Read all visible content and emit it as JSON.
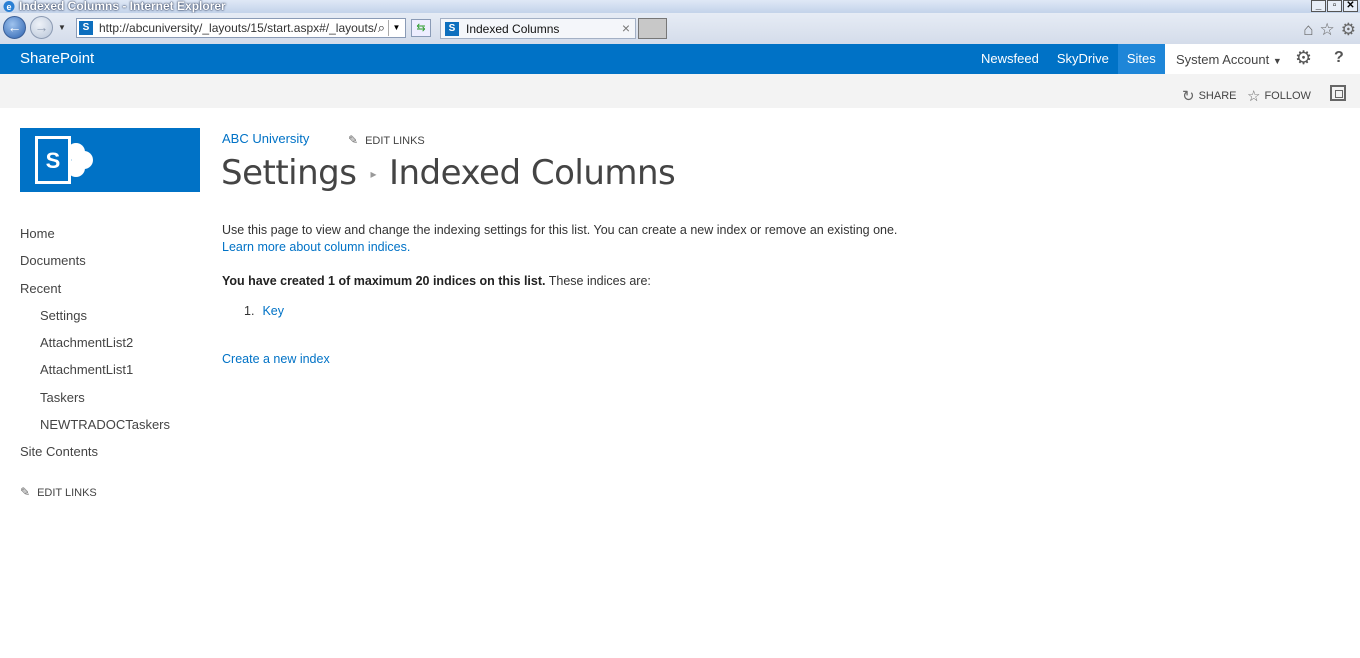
{
  "window": {
    "title": "Indexed Columns - Internet Explorer",
    "buttons": [
      "_",
      "▫",
      "✕"
    ]
  },
  "browser": {
    "url": "http://abcuniversity/_layouts/15/start.aspx#/_layouts/",
    "tab_title": "Indexed Columns"
  },
  "suitebar": {
    "brand": "SharePoint",
    "links": [
      "Newsfeed",
      "SkyDrive",
      "Sites"
    ],
    "active_link": "Sites",
    "user": "System Account",
    "help": "?",
    "accent_color": "#0072c6"
  },
  "ribbon": {
    "share": "SHARE",
    "follow": "FOLLOW"
  },
  "leftnav": {
    "items": [
      "Home",
      "Documents",
      "Recent"
    ],
    "recent_items": [
      "Settings",
      "AttachmentList2",
      "AttachmentList1",
      "Taskers",
      "NEWTRADOCTaskers"
    ],
    "site_contents": "Site Contents",
    "edit_links": "EDIT LINKS"
  },
  "main": {
    "site_name": "ABC University",
    "edit_links": "EDIT LINKS",
    "breadcrumb_parent": "Settings",
    "title": "Indexed Columns",
    "description": "Use this page to view and change the indexing settings for this list. You can create a new index or remove an existing one.",
    "learn_more": "Learn more about column indices.",
    "count_bold": "You have created 1 of maximum 20 indices on this list.",
    "count_rest": " These indices are:",
    "indices": [
      {
        "number": "1.",
        "name": "Key"
      }
    ],
    "create_link": "Create a new index"
  }
}
